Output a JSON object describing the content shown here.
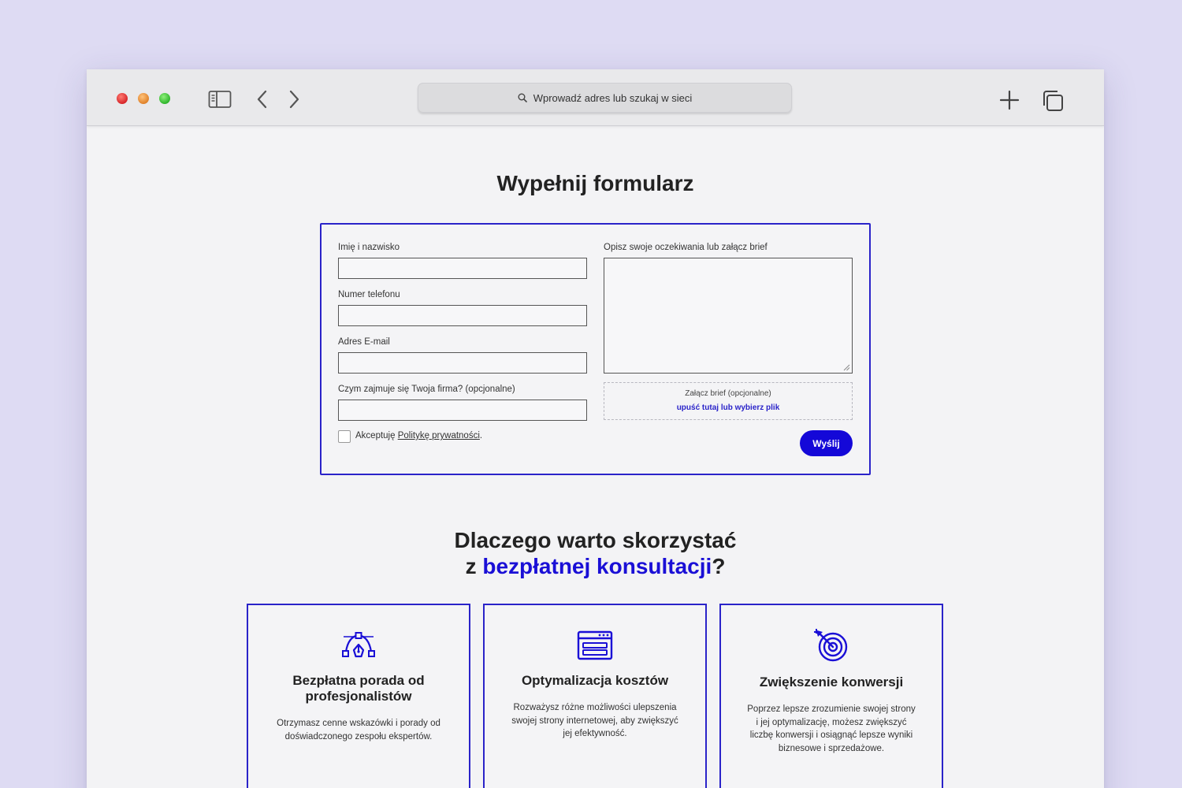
{
  "browser": {
    "url_placeholder": "Wprowadź adres lub szukaj w sieci"
  },
  "page": {
    "title": "Wypełnij formularz"
  },
  "form": {
    "name_label": "Imię i nazwisko",
    "phone_label": "Numer telefonu",
    "email_label": "Adres E-mail",
    "company_label": "Czym zajmuje się Twoja firma? (opcjonalne)",
    "description_label": "Opisz swoje oczekiwania lub załącz brief",
    "name_value": "",
    "phone_value": "",
    "email_value": "",
    "company_value": "",
    "description_value": "",
    "attach_title": "Załącz brief (opcjonalne)",
    "attach_link": "upuść tutaj lub wybierz plik",
    "consent_prefix": "Akceptuję ",
    "consent_link": "Politykę prywatności",
    "consent_suffix": ".",
    "consent_checked": false,
    "submit_label": "Wyślij"
  },
  "why": {
    "title_line1": "Dlaczego warto skorzystać",
    "title_line2_prefix": "z ",
    "title_line2_accent": "bezpłatnej konsultacji",
    "title_line2_suffix": "?"
  },
  "cards": [
    {
      "icon": "vector-pen-icon",
      "title": "Bezpłatna porada od profesjonalistów",
      "text": "Otrzymasz cenne wskazówki i porady od doświadczonego zespołu ekspertów."
    },
    {
      "icon": "browser-window-icon",
      "title": "Optymalizacja kosztów",
      "text": "Rozważysz różne możliwości ulepszenia swojej strony internetowej, aby zwiększyć jej efektywność."
    },
    {
      "icon": "target-icon",
      "title": "Zwiększenie konwersji",
      "text": "Poprzez lepsze zrozumienie swojej strony i jej optymalizację, możesz zwiększyć liczbę konwersji i osiągnąć lepsze wyniki biznesowe i sprzedażowe."
    }
  ],
  "colors": {
    "accent": "#1408d8",
    "background": "#dedbf3",
    "page": "#f3f3f5"
  }
}
